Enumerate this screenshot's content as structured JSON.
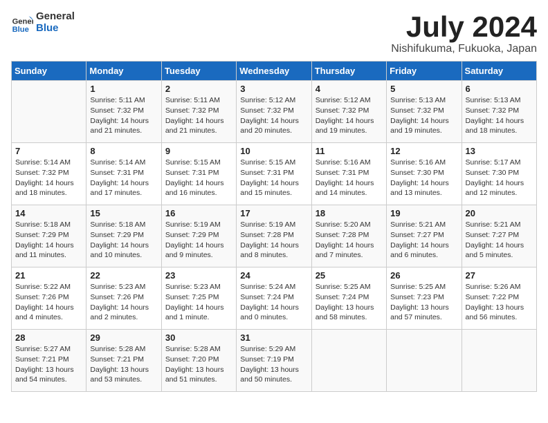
{
  "logo": {
    "line1": "General",
    "line2": "Blue"
  },
  "title": "July 2024",
  "subtitle": "Nishifukuma, Fukuoka, Japan",
  "headers": [
    "Sunday",
    "Monday",
    "Tuesday",
    "Wednesday",
    "Thursday",
    "Friday",
    "Saturday"
  ],
  "weeks": [
    [
      {
        "day": "",
        "info": ""
      },
      {
        "day": "1",
        "info": "Sunrise: 5:11 AM\nSunset: 7:32 PM\nDaylight: 14 hours\nand 21 minutes."
      },
      {
        "day": "2",
        "info": "Sunrise: 5:11 AM\nSunset: 7:32 PM\nDaylight: 14 hours\nand 21 minutes."
      },
      {
        "day": "3",
        "info": "Sunrise: 5:12 AM\nSunset: 7:32 PM\nDaylight: 14 hours\nand 20 minutes."
      },
      {
        "day": "4",
        "info": "Sunrise: 5:12 AM\nSunset: 7:32 PM\nDaylight: 14 hours\nand 19 minutes."
      },
      {
        "day": "5",
        "info": "Sunrise: 5:13 AM\nSunset: 7:32 PM\nDaylight: 14 hours\nand 19 minutes."
      },
      {
        "day": "6",
        "info": "Sunrise: 5:13 AM\nSunset: 7:32 PM\nDaylight: 14 hours\nand 18 minutes."
      }
    ],
    [
      {
        "day": "7",
        "info": "Sunrise: 5:14 AM\nSunset: 7:32 PM\nDaylight: 14 hours\nand 18 minutes."
      },
      {
        "day": "8",
        "info": "Sunrise: 5:14 AM\nSunset: 7:31 PM\nDaylight: 14 hours\nand 17 minutes."
      },
      {
        "day": "9",
        "info": "Sunrise: 5:15 AM\nSunset: 7:31 PM\nDaylight: 14 hours\nand 16 minutes."
      },
      {
        "day": "10",
        "info": "Sunrise: 5:15 AM\nSunset: 7:31 PM\nDaylight: 14 hours\nand 15 minutes."
      },
      {
        "day": "11",
        "info": "Sunrise: 5:16 AM\nSunset: 7:31 PM\nDaylight: 14 hours\nand 14 minutes."
      },
      {
        "day": "12",
        "info": "Sunrise: 5:16 AM\nSunset: 7:30 PM\nDaylight: 14 hours\nand 13 minutes."
      },
      {
        "day": "13",
        "info": "Sunrise: 5:17 AM\nSunset: 7:30 PM\nDaylight: 14 hours\nand 12 minutes."
      }
    ],
    [
      {
        "day": "14",
        "info": "Sunrise: 5:18 AM\nSunset: 7:29 PM\nDaylight: 14 hours\nand 11 minutes."
      },
      {
        "day": "15",
        "info": "Sunrise: 5:18 AM\nSunset: 7:29 PM\nDaylight: 14 hours\nand 10 minutes."
      },
      {
        "day": "16",
        "info": "Sunrise: 5:19 AM\nSunset: 7:29 PM\nDaylight: 14 hours\nand 9 minutes."
      },
      {
        "day": "17",
        "info": "Sunrise: 5:19 AM\nSunset: 7:28 PM\nDaylight: 14 hours\nand 8 minutes."
      },
      {
        "day": "18",
        "info": "Sunrise: 5:20 AM\nSunset: 7:28 PM\nDaylight: 14 hours\nand 7 minutes."
      },
      {
        "day": "19",
        "info": "Sunrise: 5:21 AM\nSunset: 7:27 PM\nDaylight: 14 hours\nand 6 minutes."
      },
      {
        "day": "20",
        "info": "Sunrise: 5:21 AM\nSunset: 7:27 PM\nDaylight: 14 hours\nand 5 minutes."
      }
    ],
    [
      {
        "day": "21",
        "info": "Sunrise: 5:22 AM\nSunset: 7:26 PM\nDaylight: 14 hours\nand 4 minutes."
      },
      {
        "day": "22",
        "info": "Sunrise: 5:23 AM\nSunset: 7:26 PM\nDaylight: 14 hours\nand 2 minutes."
      },
      {
        "day": "23",
        "info": "Sunrise: 5:23 AM\nSunset: 7:25 PM\nDaylight: 14 hours\nand 1 minute."
      },
      {
        "day": "24",
        "info": "Sunrise: 5:24 AM\nSunset: 7:24 PM\nDaylight: 14 hours\nand 0 minutes."
      },
      {
        "day": "25",
        "info": "Sunrise: 5:25 AM\nSunset: 7:24 PM\nDaylight: 13 hours\nand 58 minutes."
      },
      {
        "day": "26",
        "info": "Sunrise: 5:25 AM\nSunset: 7:23 PM\nDaylight: 13 hours\nand 57 minutes."
      },
      {
        "day": "27",
        "info": "Sunrise: 5:26 AM\nSunset: 7:22 PM\nDaylight: 13 hours\nand 56 minutes."
      }
    ],
    [
      {
        "day": "28",
        "info": "Sunrise: 5:27 AM\nSunset: 7:21 PM\nDaylight: 13 hours\nand 54 minutes."
      },
      {
        "day": "29",
        "info": "Sunrise: 5:28 AM\nSunset: 7:21 PM\nDaylight: 13 hours\nand 53 minutes."
      },
      {
        "day": "30",
        "info": "Sunrise: 5:28 AM\nSunset: 7:20 PM\nDaylight: 13 hours\nand 51 minutes."
      },
      {
        "day": "31",
        "info": "Sunrise: 5:29 AM\nSunset: 7:19 PM\nDaylight: 13 hours\nand 50 minutes."
      },
      {
        "day": "",
        "info": ""
      },
      {
        "day": "",
        "info": ""
      },
      {
        "day": "",
        "info": ""
      }
    ]
  ]
}
